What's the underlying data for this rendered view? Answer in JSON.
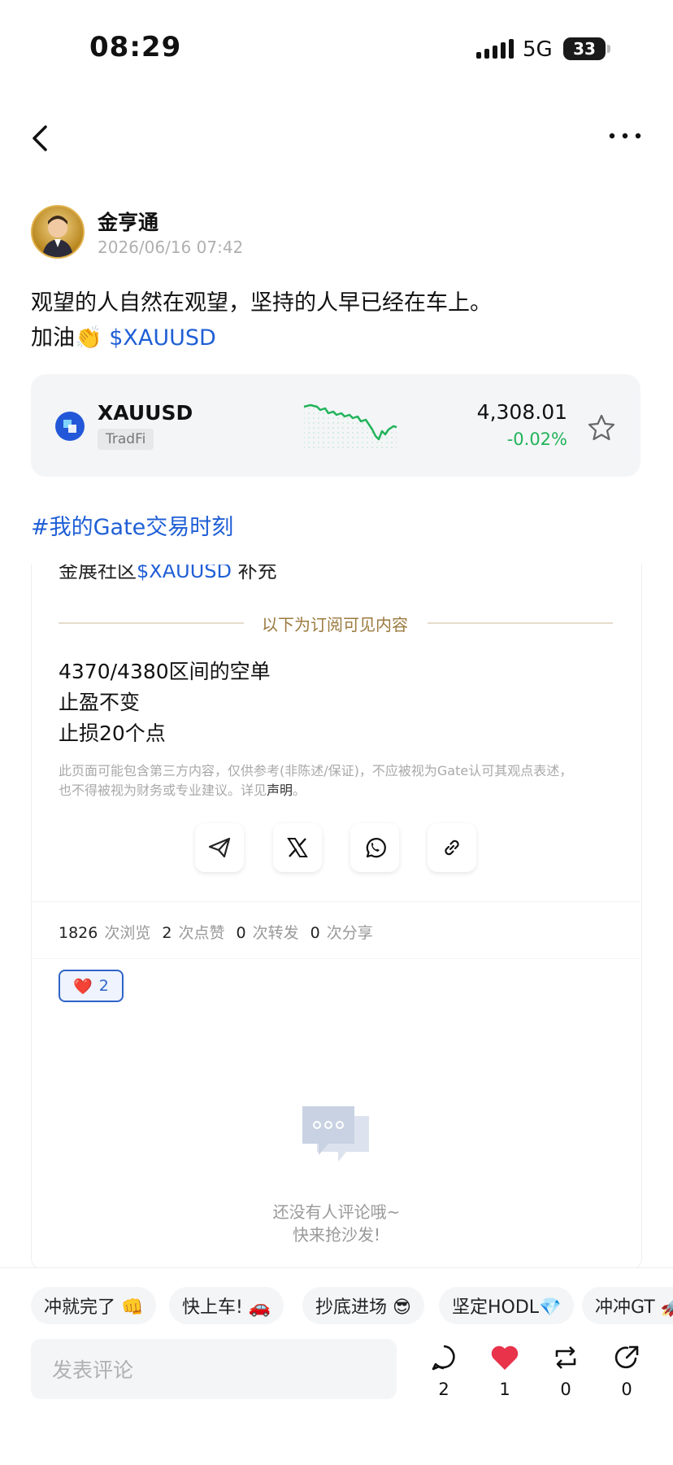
{
  "status_bar": {
    "time": "08:29",
    "network": "5G",
    "battery": "33"
  },
  "author": {
    "name": "金亨通",
    "timestamp": "2026/06/16 07:42"
  },
  "post": {
    "line1": "观望的人自然在观望，坚持的人早已经在车上。",
    "line2_prefix": "加油👏 ",
    "line2_link": "$XAUUSD"
  },
  "ticker": {
    "symbol": "XAUUSD",
    "tag": "TradFi",
    "price": "4,308.01",
    "change": "-0.02%",
    "change_color": "#21b35a"
  },
  "hashtag": "#我的Gate交易时刻",
  "content": {
    "cut_prefix": "金展社区",
    "cut_link": "$XAUUSD",
    "cut_suffix": " 补充",
    "divider_label": "以下为订阅可见内容",
    "lines": [
      "4370/4380区间的空单",
      "止盈不变",
      "止损20个点"
    ],
    "disclaimer_line1": "此页面可能包含第三方内容，仅供参考(非陈述/保证)，不应被视为Gate认可其观点表述，",
    "disclaimer_line2_prefix": "也不得被视为财务或专业建议。详见",
    "disclaimer_link": "声明",
    "disclaimer_suffix": "。"
  },
  "stats": {
    "views": "1826",
    "views_label": "次浏览",
    "likes": "2",
    "likes_label": "次点赞",
    "reposts": "0",
    "reposts_label": "次转发",
    "shares": "0",
    "shares_label": "次分享"
  },
  "reaction": {
    "emoji": "❤️",
    "count": "2"
  },
  "empty_comments": {
    "line1": "还没有人评论哦~",
    "line2": "快来抢沙发!"
  },
  "quick_replies": [
    "冲就完了 👊",
    "快上车! 🚗",
    "抄底进场 😎",
    "坚定HODL💎",
    "冲冲GT 🚀"
  ],
  "comment_placeholder": "发表评论",
  "actions": {
    "comments": "2",
    "likes": "1",
    "reposts": "0",
    "shares": "0"
  },
  "colors": {
    "link": "#1f5fd6",
    "accent_like": "#e8334a",
    "positive": "#21b35a"
  }
}
